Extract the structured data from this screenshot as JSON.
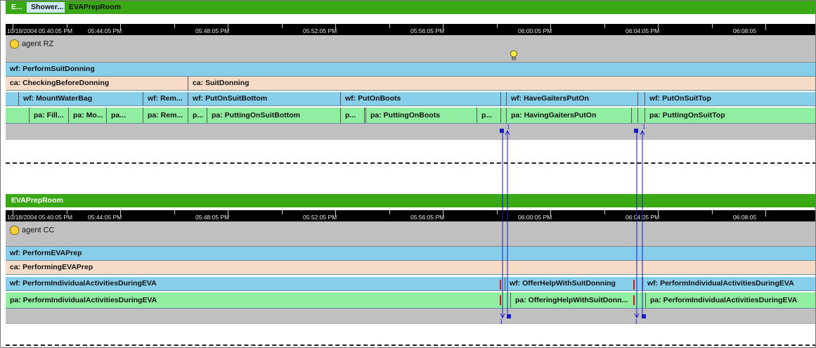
{
  "tabs": [
    {
      "label": "E..."
    },
    {
      "label": "Shower..."
    },
    {
      "label": "EVAPrepRoom"
    }
  ],
  "top_panel": {
    "timeline_labels": [
      "10/18/2004 05:40:05 PM",
      "05:44:05 PM",
      "05:48:05 PM",
      "05:52:05 PM",
      "05:56:05 PM",
      "06:00:05 PM",
      "06:04:05 PM",
      "06:08:05"
    ],
    "agent": "agent RZ",
    "wf_main": "wf: PerformSuitDonning",
    "ca": [
      {
        "label": "ca: CheckingBeforeDonning"
      },
      {
        "label": "ca: SuitDonning"
      }
    ],
    "wf": [
      {
        "label": "wf: MountWaterBag"
      },
      {
        "label": "wf: Rem..."
      },
      {
        "label": "wf: PutOnSuitBottom"
      },
      {
        "label": "wf: PutOnBoots"
      },
      {
        "label": ""
      },
      {
        "label": "wf: HaveGaitersPutOn"
      },
      {
        "label": ""
      },
      {
        "label": "wf: PutOnSuitTop"
      }
    ],
    "pa": [
      {
        "label": "pa: Fill..."
      },
      {
        "label": "pa: Mo..."
      },
      {
        "label": "pa..."
      },
      {
        "label": "pa: Rem..."
      },
      {
        "label": "p..."
      },
      {
        "label": "pa: PuttingOnSuitBottom"
      },
      {
        "label": "p..."
      },
      {
        "label": "pa: PuttingOnBoots"
      },
      {
        "label": "p..."
      },
      {
        "label": ""
      },
      {
        "label": "pa: HavingGaitersPutOn"
      },
      {
        "label": ""
      },
      {
        "label": ""
      },
      {
        "label": "pa: PuttingOnSuitTop"
      }
    ]
  },
  "bottom_panel": {
    "location": "EVAPrepRoom",
    "timeline_labels": [
      "10/18/2004 05:40:05 PM",
      "05:44:05 PM",
      "05:48:05 PM",
      "05:52:05 PM",
      "05:56:05 PM",
      "06:00:05 PM",
      "06:04:05 PM",
      "06:08:05"
    ],
    "agent": "agent CC",
    "wf_main": "wf: PerformEVAPrep",
    "ca": "ca: PerformingEVAPrep",
    "wf": [
      {
        "label": "wf: PerformIndividualActivitiesDuringEVA"
      },
      {
        "label": "wf: OfferHelpWithSuitDonning"
      },
      {
        "label": "wf: PerformIndividualActivitiesDuringEVA"
      }
    ],
    "pa": [
      {
        "label": "pa: PerformIndividualActivitiesDuringEVA"
      },
      {
        "label": "pa: OfferingHelpWithSuitDonn..."
      },
      {
        "label": "pa: PerformIndividualActivitiesDuringEVA"
      }
    ]
  },
  "arrow_labels": [
    "1",
    "1",
    "1",
    "1"
  ],
  "colors": {
    "green_bar": "#3aa814",
    "wf": "#87ceeb",
    "ca": "#f6dcc6",
    "pa": "#90eea0",
    "grey": "#c0c0c0",
    "arrow": "#1a1acc"
  },
  "icons": [
    "hand-icon",
    "lightbulb-icon"
  ]
}
